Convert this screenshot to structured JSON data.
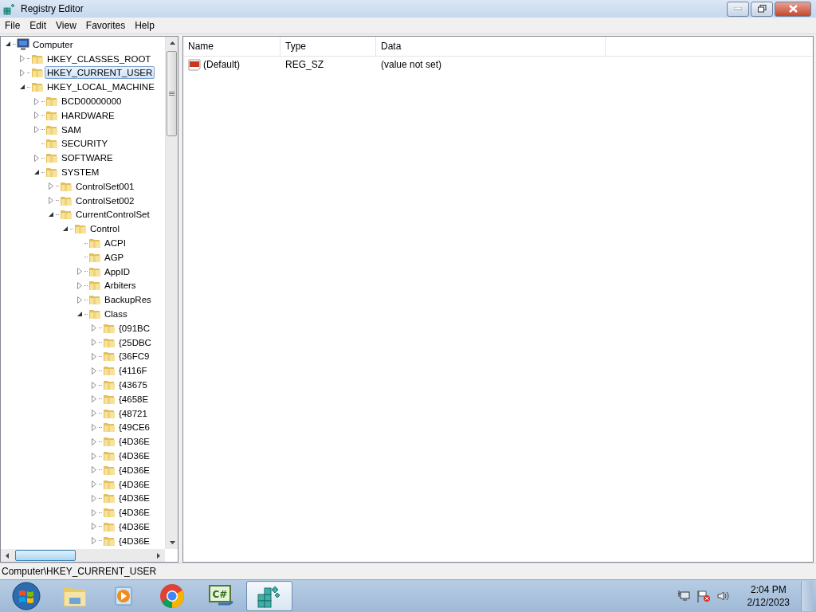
{
  "window": {
    "title": "Registry Editor"
  },
  "menu": [
    "File",
    "Edit",
    "View",
    "Favorites",
    "Help"
  ],
  "tree": [
    {
      "label": "Computer",
      "kind": "computer",
      "expandable": true,
      "expanded": true,
      "selected": false,
      "children": [
        {
          "label": "HKEY_CLASSES_ROOT",
          "kind": "folder",
          "expandable": true,
          "expanded": false,
          "selected": false
        },
        {
          "label": "HKEY_CURRENT_USER",
          "kind": "folder",
          "expandable": true,
          "expanded": false,
          "selected": true
        },
        {
          "label": "HKEY_LOCAL_MACHINE",
          "kind": "folder",
          "expandable": true,
          "expanded": true,
          "selected": false,
          "children": [
            {
              "label": "BCD00000000",
              "kind": "folder",
              "expandable": true,
              "expanded": false,
              "selected": false
            },
            {
              "label": "HARDWARE",
              "kind": "folder",
              "expandable": true,
              "expanded": false,
              "selected": false
            },
            {
              "label": "SAM",
              "kind": "folder",
              "expandable": true,
              "expanded": false,
              "selected": false
            },
            {
              "label": "SECURITY",
              "kind": "folder",
              "expandable": false,
              "selected": false
            },
            {
              "label": "SOFTWARE",
              "kind": "folder",
              "expandable": true,
              "expanded": false,
              "selected": false
            },
            {
              "label": "SYSTEM",
              "kind": "folder",
              "expandable": true,
              "expanded": true,
              "selected": false,
              "children": [
                {
                  "label": "ControlSet001",
                  "kind": "folder",
                  "expandable": true,
                  "expanded": false,
                  "selected": false
                },
                {
                  "label": "ControlSet002",
                  "kind": "folder",
                  "expandable": true,
                  "expanded": false,
                  "selected": false
                },
                {
                  "label": "CurrentControlSet",
                  "kind": "folder",
                  "expandable": true,
                  "expanded": true,
                  "selected": false,
                  "children": [
                    {
                      "label": "Control",
                      "kind": "folder",
                      "expandable": true,
                      "expanded": true,
                      "selected": false,
                      "children": [
                        {
                          "label": "ACPI",
                          "kind": "folder",
                          "expandable": false,
                          "selected": false
                        },
                        {
                          "label": "AGP",
                          "kind": "folder",
                          "expandable": false,
                          "selected": false
                        },
                        {
                          "label": "AppID",
                          "kind": "folder",
                          "expandable": true,
                          "expanded": false,
                          "selected": false
                        },
                        {
                          "label": "Arbiters",
                          "kind": "folder",
                          "expandable": true,
                          "expanded": false,
                          "selected": false
                        },
                        {
                          "label": "BackupRes",
                          "kind": "folder",
                          "expandable": true,
                          "expanded": false,
                          "selected": false
                        },
                        {
                          "label": "Class",
                          "kind": "folder",
                          "expandable": true,
                          "expanded": true,
                          "selected": false,
                          "children": [
                            {
                              "label": "{091BC",
                              "kind": "folder",
                              "expandable": true,
                              "expanded": false,
                              "selected": false
                            },
                            {
                              "label": "{25DBC",
                              "kind": "folder",
                              "expandable": true,
                              "expanded": false,
                              "selected": false
                            },
                            {
                              "label": "{36FC9",
                              "kind": "folder",
                              "expandable": true,
                              "expanded": false,
                              "selected": false
                            },
                            {
                              "label": "{4116F",
                              "kind": "folder",
                              "expandable": true,
                              "expanded": false,
                              "selected": false
                            },
                            {
                              "label": "{43675",
                              "kind": "folder",
                              "expandable": true,
                              "expanded": false,
                              "selected": false
                            },
                            {
                              "label": "{4658E",
                              "kind": "folder",
                              "expandable": true,
                              "expanded": false,
                              "selected": false
                            },
                            {
                              "label": "{48721",
                              "kind": "folder",
                              "expandable": true,
                              "expanded": false,
                              "selected": false
                            },
                            {
                              "label": "{49CE6",
                              "kind": "folder",
                              "expandable": true,
                              "expanded": false,
                              "selected": false
                            },
                            {
                              "label": "{4D36E",
                              "kind": "folder",
                              "expandable": true,
                              "expanded": false,
                              "selected": false
                            },
                            {
                              "label": "{4D36E",
                              "kind": "folder",
                              "expandable": true,
                              "expanded": false,
                              "selected": false
                            },
                            {
                              "label": "{4D36E",
                              "kind": "folder",
                              "expandable": true,
                              "expanded": false,
                              "selected": false
                            },
                            {
                              "label": "{4D36E",
                              "kind": "folder",
                              "expandable": true,
                              "expanded": false,
                              "selected": false
                            },
                            {
                              "label": "{4D36E",
                              "kind": "folder",
                              "expandable": true,
                              "expanded": false,
                              "selected": false
                            },
                            {
                              "label": "{4D36E",
                              "kind": "folder",
                              "expandable": true,
                              "expanded": false,
                              "selected": false
                            },
                            {
                              "label": "{4D36E",
                              "kind": "folder",
                              "expandable": true,
                              "expanded": false,
                              "selected": false
                            },
                            {
                              "label": "{4D36E",
                              "kind": "folder",
                              "expandable": true,
                              "expanded": false,
                              "selected": false
                            }
                          ]
                        }
                      ]
                    }
                  ]
                }
              ]
            }
          ]
        }
      ]
    }
  ],
  "values": {
    "columns": [
      "Name",
      "Type",
      "Data"
    ],
    "rows": [
      {
        "kind": "string",
        "name": "(Default)",
        "type": "REG_SZ",
        "data": "(value not set)"
      }
    ]
  },
  "status_bar": "Computer\\HKEY_CURRENT_USER",
  "taskbar": {
    "apps": [
      {
        "kind": "start",
        "selected": false
      },
      {
        "kind": "explorer",
        "selected": false
      },
      {
        "kind": "media",
        "selected": false
      },
      {
        "kind": "chrome",
        "selected": false
      },
      {
        "kind": "csharp",
        "label": "C#",
        "selected": false
      },
      {
        "kind": "regedit",
        "selected": true
      }
    ],
    "clock": {
      "time": "2:04 PM",
      "date": "2/12/2023"
    }
  }
}
